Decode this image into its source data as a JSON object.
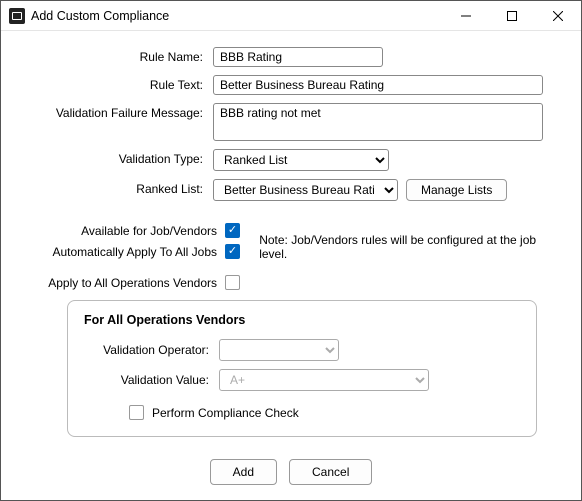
{
  "window": {
    "title": "Add Custom Compliance"
  },
  "labels": {
    "rule_name": "Rule Name:",
    "rule_text": "Rule Text:",
    "validation_failure_message": "Validation Failure Message:",
    "validation_type": "Validation Type:",
    "ranked_list": "Ranked List:",
    "available": "Available for Job/Vendors",
    "auto_apply": "Automatically Apply To All Jobs",
    "apply_ops": "Apply to All Operations Vendors",
    "note": "Note:  Job/Vendors rules will be configured at the job level.",
    "manage_lists": "Manage Lists"
  },
  "values": {
    "rule_name": "BBB Rating",
    "rule_text": "Better Business Bureau Rating",
    "failure_message": "BBB rating not met",
    "validation_type": "Ranked List",
    "ranked_list": "Better Business Bureau Rating",
    "available_checked": true,
    "auto_apply_checked": true,
    "apply_ops_checked": false
  },
  "group": {
    "title": "For All Operations Vendors",
    "operator_label": "Validation Operator:",
    "value_label": "Validation Value:",
    "operator_value": "",
    "value_value": "A+",
    "perform_check_label": "Perform Compliance Check",
    "perform_check_checked": false
  },
  "footer": {
    "add": "Add",
    "cancel": "Cancel"
  }
}
